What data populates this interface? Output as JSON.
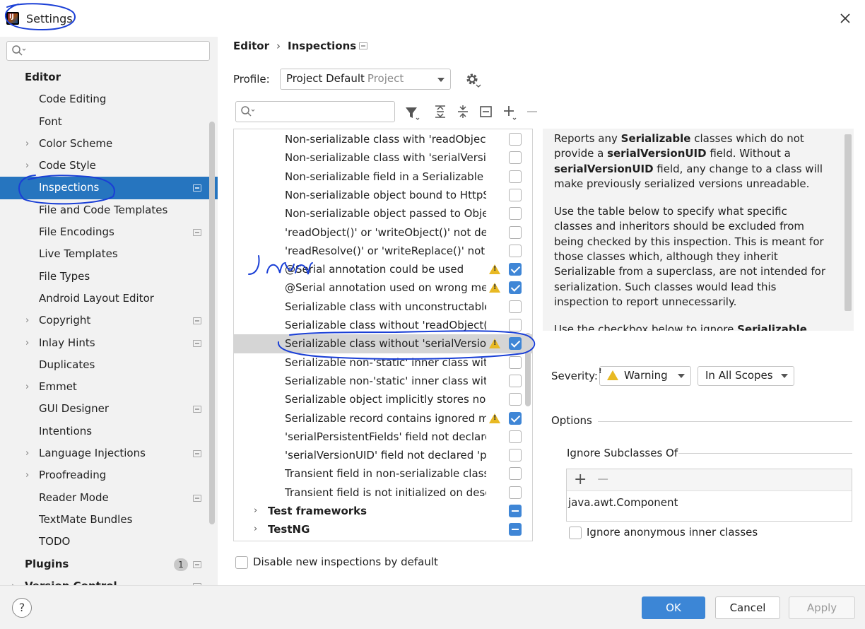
{
  "window": {
    "title": "Settings"
  },
  "sidebar": {
    "search_placeholder": "",
    "items": [
      {
        "label": "Editor",
        "level": 0,
        "bold": true,
        "expand": false,
        "proj": false
      },
      {
        "label": "Code Editing",
        "level": 1,
        "expand": false,
        "proj": false
      },
      {
        "label": "Font",
        "level": 1,
        "expand": false,
        "proj": false
      },
      {
        "label": "Color Scheme",
        "level": 1,
        "expand": true,
        "proj": false
      },
      {
        "label": "Code Style",
        "level": 1,
        "expand": true,
        "proj": false
      },
      {
        "label": "Inspections",
        "level": 1,
        "expand": false,
        "proj": true,
        "selected": true
      },
      {
        "label": "File and Code Templates",
        "level": 1,
        "expand": false,
        "proj": false
      },
      {
        "label": "File Encodings",
        "level": 1,
        "expand": false,
        "proj": true
      },
      {
        "label": "Live Templates",
        "level": 1,
        "expand": false,
        "proj": false
      },
      {
        "label": "File Types",
        "level": 1,
        "expand": false,
        "proj": false
      },
      {
        "label": "Android Layout Editor",
        "level": 1,
        "expand": false,
        "proj": false
      },
      {
        "label": "Copyright",
        "level": 1,
        "expand": true,
        "proj": true
      },
      {
        "label": "Inlay Hints",
        "level": 1,
        "expand": true,
        "proj": true
      },
      {
        "label": "Duplicates",
        "level": 1,
        "expand": false,
        "proj": false
      },
      {
        "label": "Emmet",
        "level": 1,
        "expand": true,
        "proj": false
      },
      {
        "label": "GUI Designer",
        "level": 1,
        "expand": false,
        "proj": true
      },
      {
        "label": "Intentions",
        "level": 1,
        "expand": false,
        "proj": false
      },
      {
        "label": "Language Injections",
        "level": 1,
        "expand": true,
        "proj": true
      },
      {
        "label": "Proofreading",
        "level": 1,
        "expand": true,
        "proj": false
      },
      {
        "label": "Reader Mode",
        "level": 1,
        "expand": false,
        "proj": true
      },
      {
        "label": "TextMate Bundles",
        "level": 1,
        "expand": false,
        "proj": false
      },
      {
        "label": "TODO",
        "level": 1,
        "expand": false,
        "proj": false
      },
      {
        "label": "Plugins",
        "level": 0,
        "bold": true,
        "expand": false,
        "proj": true,
        "badge": "1"
      },
      {
        "label": "Version Control",
        "level": 0,
        "bold": true,
        "expand": true,
        "proj": true
      }
    ]
  },
  "breadcrumb": {
    "parent": "Editor",
    "separator": "›",
    "current": "Inspections"
  },
  "profile": {
    "label": "Profile:",
    "value": "Project Default",
    "scope": "Project"
  },
  "inspections": {
    "search_placeholder": "",
    "rows": [
      {
        "label": "Non-serializable class with 'readObject()' or 'writeObject()'",
        "warn": false,
        "state": "off"
      },
      {
        "label": "Non-serializable class with 'serialVersionUID'",
        "warn": false,
        "state": "off"
      },
      {
        "label": "Non-serializable field in a Serializable class",
        "warn": false,
        "state": "off"
      },
      {
        "label": "Non-serializable object bound to HttpSession",
        "warn": false,
        "state": "off"
      },
      {
        "label": "Non-serializable object passed to ObjectOutputStream",
        "warn": false,
        "state": "off"
      },
      {
        "label": "'readObject()' or 'writeObject()' not declared 'private'",
        "warn": false,
        "state": "off"
      },
      {
        "label": "'readResolve()' or 'writeReplace()' not declared 'protected'",
        "warn": false,
        "state": "off"
      },
      {
        "label": "@Serial annotation could be used",
        "warn": true,
        "state": "on"
      },
      {
        "label": "@Serial annotation used on wrong member",
        "warn": true,
        "state": "on"
      },
      {
        "label": "Serializable class with unconstructable ancestor",
        "warn": false,
        "state": "off"
      },
      {
        "label": "Serializable class without 'readObject()' and 'writeObject()'",
        "warn": false,
        "state": "off"
      },
      {
        "label": "Serializable class without 'serialVersionUID'",
        "warn": true,
        "state": "on",
        "selected": true
      },
      {
        "label": "Serializable non-'static' inner class without 'serialVersionUID'",
        "warn": false,
        "state": "off"
      },
      {
        "label": "Serializable non-'static' inner class without 'static' modifier",
        "warn": false,
        "state": "off"
      },
      {
        "label": "Serializable object implicitly stores non-Serializable object",
        "warn": false,
        "state": "off"
      },
      {
        "label": "Serializable record contains ignored members",
        "warn": true,
        "state": "on"
      },
      {
        "label": "'serialPersistentFields' field not declared 'private static final'",
        "warn": false,
        "state": "off"
      },
      {
        "label": "'serialVersionUID' field not declared 'private static final long'",
        "warn": false,
        "state": "off"
      },
      {
        "label": "Transient field in non-serializable class",
        "warn": false,
        "state": "off"
      },
      {
        "label": "Transient field is not initialized on deserialization",
        "warn": false,
        "state": "off"
      },
      {
        "label": "Test frameworks",
        "warn": false,
        "state": "mix",
        "group": true
      },
      {
        "label": "TestNG",
        "warn": false,
        "state": "mix",
        "group": true
      }
    ],
    "disable_new_label": "Disable new inspections by default"
  },
  "description": {
    "p1_a": "Reports any ",
    "p1_b": "Serializable",
    "p1_c": " classes which do not provide a ",
    "p1_d": "serialVersionUID",
    "p1_e": " field. Without a ",
    "p1_f": "serialVersionUID",
    "p1_g": " field, any change to a class will make previously serialized versions unreadable.",
    "p2": "Use the table below to specify what specific classes and inheritors should be excluded from being checked by this inspection. This is meant for those classes which, although they inherit Serializable from a superclass, are not intended for serialization. Such classes would lead this inspection to report unnecessarily.",
    "p3_a": "Use the checkbox below to ignore ",
    "p3_b": "Serializable"
  },
  "severity": {
    "label": "Severity:",
    "value": "Warning",
    "scope": "In All Scopes"
  },
  "options": {
    "label": "Options",
    "ignore_subclasses_label": "Ignore Subclasses Of",
    "add": "+",
    "remove": "−",
    "value": "java.awt.Component",
    "anon_label": "Ignore anonymous inner classes"
  },
  "buttons": {
    "help": "?",
    "ok": "OK",
    "cancel": "Cancel",
    "apply": "Apply"
  },
  "colors": {
    "accent": "#2675bf",
    "warning": "#e8b923",
    "checkbox": "#3f86d6"
  }
}
